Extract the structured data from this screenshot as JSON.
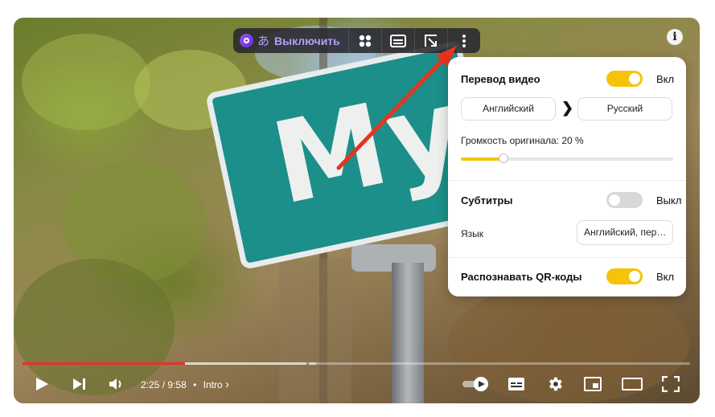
{
  "toolbar": {
    "disable_label": "Выключить",
    "translate_glyph": "あ",
    "buttons": [
      "alice-icon",
      "apps-grid-icon",
      "subtitles-icon",
      "resize-icon",
      "more-vertical-icon"
    ]
  },
  "info_glyph": "i",
  "sign_text": "My",
  "panel": {
    "video_translation": {
      "title": "Перевод видео",
      "toggle_on": true,
      "state": "Вкл",
      "source_language": "Английский",
      "target_language": "Русский",
      "arrow": "❯",
      "volume_label": "Громкость оригинала: 20 %",
      "volume_percent": 20
    },
    "subtitles": {
      "title": "Субтитры",
      "toggle_on": false,
      "state": "Выкл",
      "language_label": "Язык",
      "language_value": "Английский, пер…"
    },
    "qr": {
      "title": "Распознавать QR-коды",
      "toggle_on": true,
      "state": "Вкл"
    }
  },
  "player": {
    "current_time": "2:25",
    "duration": "9:58",
    "separator": "/",
    "bullet": "•",
    "chapter": "Intro",
    "chapter_chevron": "›",
    "progress_fraction": 0.243,
    "loaded_fraction": 0.44
  },
  "colors": {
    "accent_yellow": "#f6c30b",
    "progress_red": "#e5312b",
    "toolbar_purple": "#b79cff",
    "arrow_red": "#e8331f"
  }
}
